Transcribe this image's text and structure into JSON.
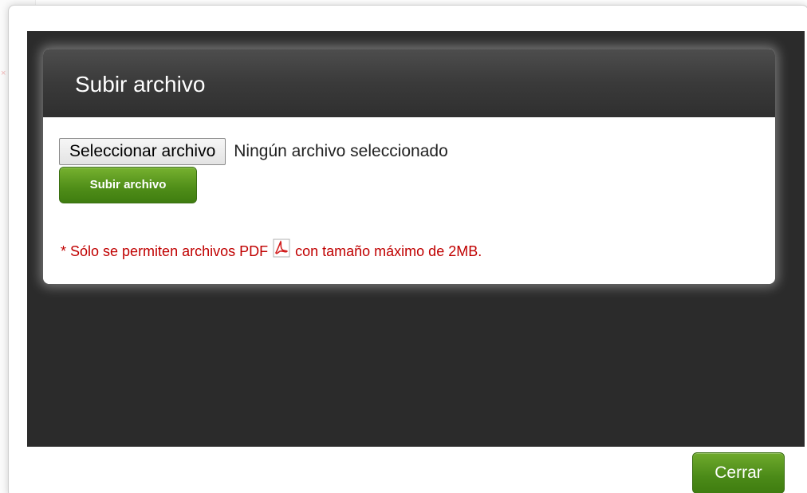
{
  "dialog": {
    "title": "Subir archivo",
    "file_input": {
      "button_label": "Seleccionar archivo",
      "status_text": "Ningún archivo seleccionado"
    },
    "upload_button_label": "Subir archivo",
    "note": {
      "prefix": "* Sólo se permiten archivos PDF",
      "suffix": "con tamaño máximo de 2MB.",
      "icon": "pdf-icon"
    },
    "close_button_label": "Cerrar"
  },
  "colors": {
    "header_dark": "#3a3a3a",
    "content_dark": "#2b2b2b",
    "button_green": "#4f8d18",
    "note_red": "#c00000"
  }
}
